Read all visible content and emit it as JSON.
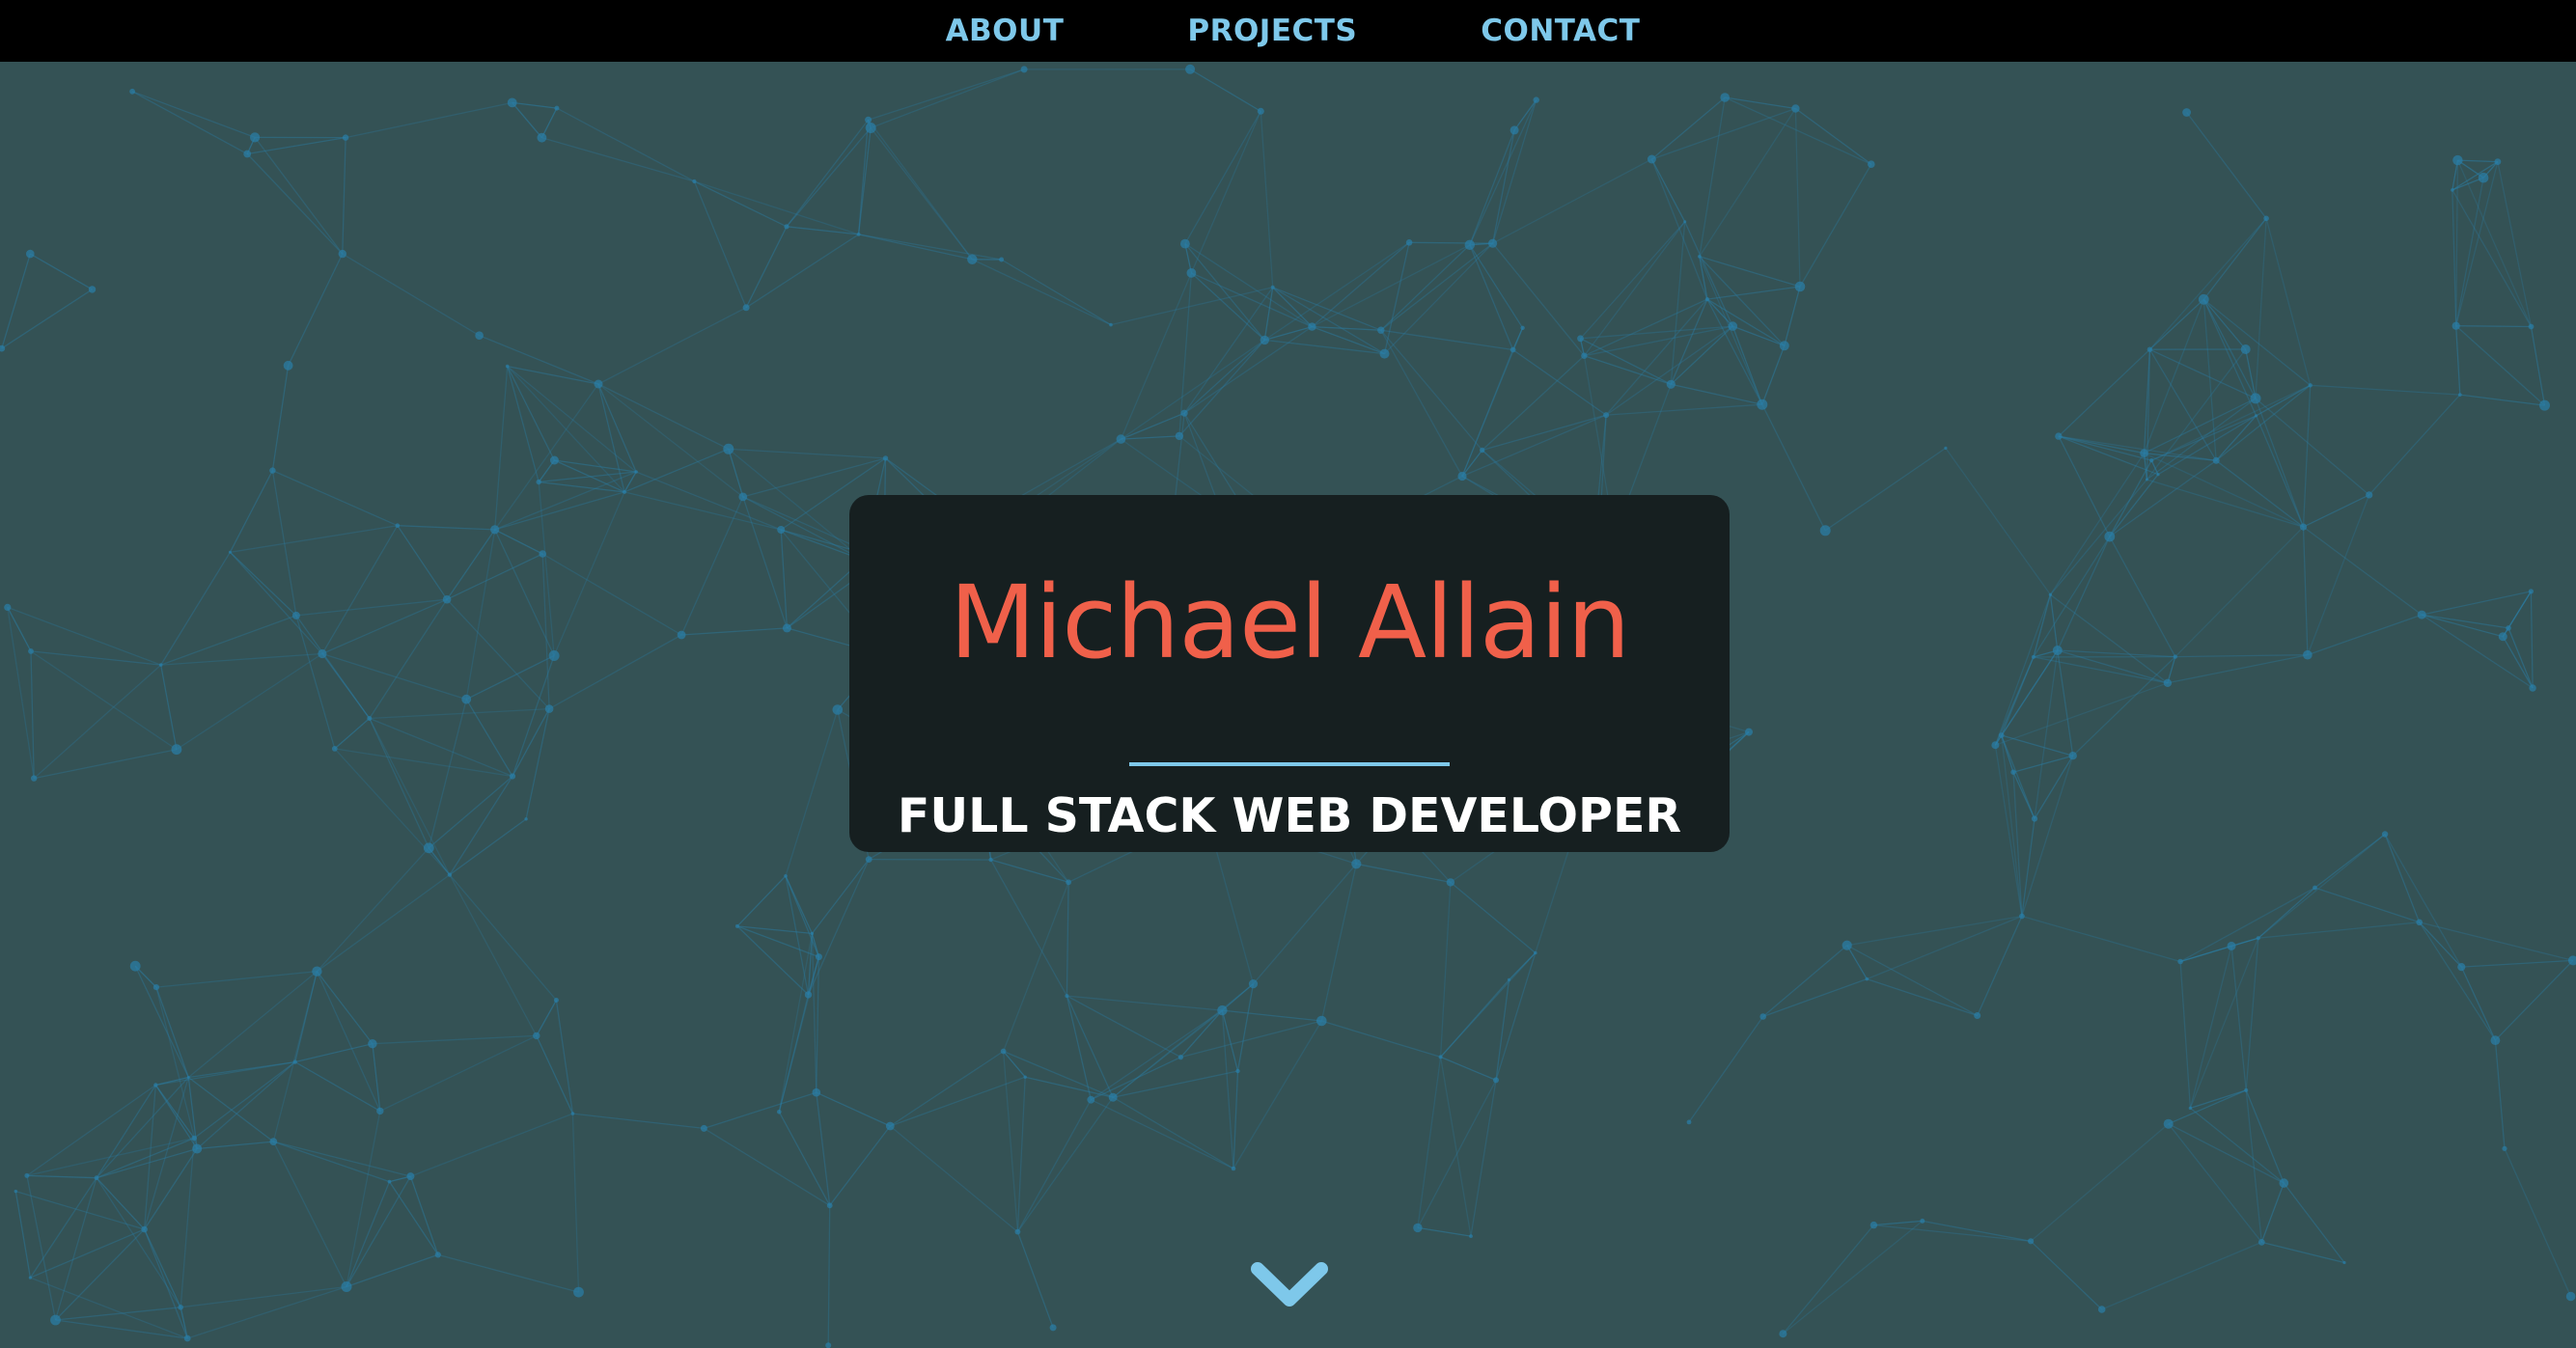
{
  "nav": {
    "items": [
      {
        "label": "ABOUT"
      },
      {
        "label": "PROJECTS"
      },
      {
        "label": "CONTACT"
      }
    ]
  },
  "hero": {
    "name": "Michael Allain",
    "role": "FULL STACK WEB DEVELOPER"
  },
  "icons": {
    "scroll_down": "chevron-down-icon"
  },
  "colors": {
    "navbar_bg": "#000000",
    "nav_link": "#7ec8ea",
    "hero_bg": "#345255",
    "card_bg": "#161f20",
    "name": "#f0604a",
    "divider": "#7ec8ea",
    "role": "#ffffff",
    "network": "#2a7fa8"
  }
}
